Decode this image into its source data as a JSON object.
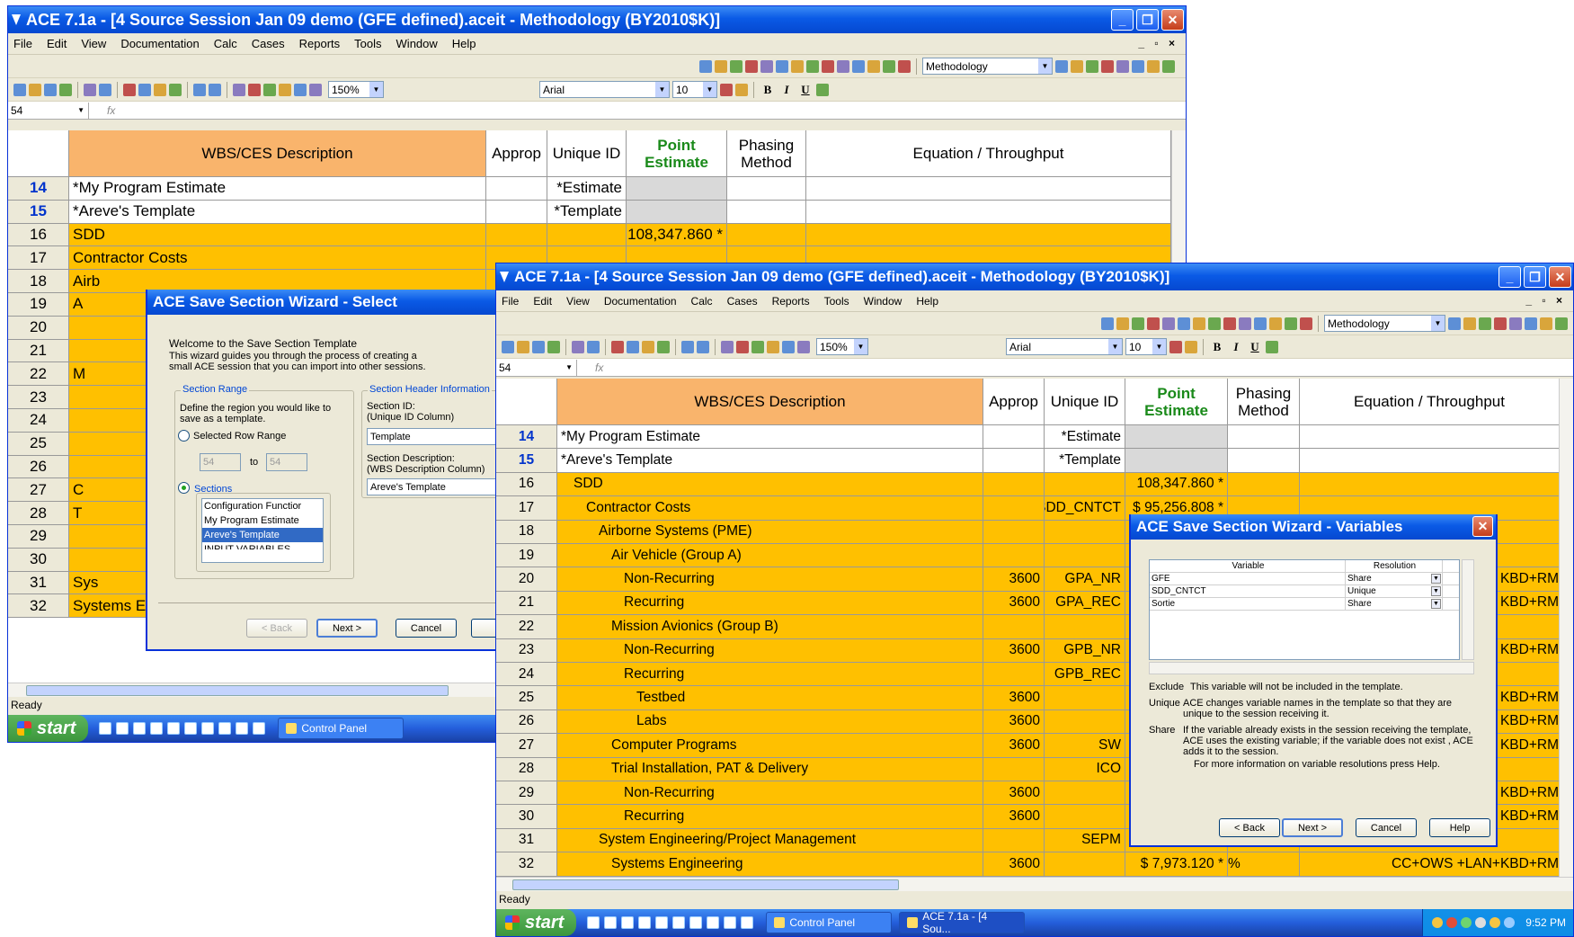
{
  "window_title": "ACE 7.1a - [4 Source Session Jan 09 demo (GFE defined).aceit - Methodology (BY2010$K)]",
  "menu": [
    "File",
    "Edit",
    "View",
    "Documentation",
    "Calc",
    "Cases",
    "Reports",
    "Tools",
    "Window",
    "Help"
  ],
  "mdi_controls": "_ ▫ ×",
  "toolbar": {
    "view_combo": "Methodology",
    "zoom": "150%",
    "font": "Arial",
    "font_size": "10",
    "bold": "B",
    "italic": "I",
    "underline": "U"
  },
  "name_box": "54",
  "fx_label": "fx",
  "columns": {
    "desc": "WBS/CES Description",
    "approp": "Approp",
    "uid": "Unique ID",
    "pe_line1": "Point",
    "pe_line2": "Estimate",
    "phase_line1": "Phasing",
    "phase_line2": "Method",
    "eq": "Equation / Throughput"
  },
  "back_rows": [
    {
      "num": "14",
      "desc": "*My Program Estimate",
      "uid": "*Estimate",
      "pe": "",
      "style": "white"
    },
    {
      "num": "15",
      "desc": "*Areve's Template",
      "uid": "*Template",
      "pe": "",
      "style": "white"
    },
    {
      "num": "16",
      "desc": "SDD",
      "uid": "",
      "pe": "108,347.860 *",
      "style": "yellow"
    },
    {
      "num": "17",
      "desc": "Contractor Costs",
      "uid": "",
      "pe": "",
      "style": "yellow"
    },
    {
      "num": "18",
      "desc": "Airb",
      "uid": "",
      "pe": "",
      "style": "yellow"
    },
    {
      "num": "19",
      "desc": "A",
      "uid": "",
      "pe": "",
      "style": "yellow"
    },
    {
      "num": "20",
      "desc": "",
      "uid": "",
      "pe": "",
      "style": "yellow"
    },
    {
      "num": "21",
      "desc": "",
      "uid": "",
      "pe": "",
      "style": "yellow"
    },
    {
      "num": "22",
      "desc": "M",
      "uid": "",
      "pe": "",
      "style": "yellow"
    },
    {
      "num": "23",
      "desc": "",
      "uid": "",
      "pe": "",
      "style": "yellow"
    },
    {
      "num": "24",
      "desc": "",
      "uid": "",
      "pe": "",
      "style": "yellow"
    },
    {
      "num": "25",
      "desc": "",
      "uid": "",
      "pe": "",
      "style": "yellow"
    },
    {
      "num": "26",
      "desc": "",
      "uid": "",
      "pe": "",
      "style": "yellow"
    },
    {
      "num": "27",
      "desc": "C",
      "uid": "",
      "pe": "",
      "style": "yellow"
    },
    {
      "num": "28",
      "desc": "T",
      "uid": "",
      "pe": "",
      "style": "yellow"
    },
    {
      "num": "29",
      "desc": "",
      "uid": "",
      "pe": "",
      "style": "yellow"
    },
    {
      "num": "30",
      "desc": "",
      "uid": "",
      "pe": "",
      "style": "yellow"
    },
    {
      "num": "31",
      "desc": "Sys",
      "uid": "",
      "pe": "",
      "style": "yellow"
    },
    {
      "num": "32",
      "desc": "Systems Engineering",
      "uid": "",
      "pe": "",
      "style": "yellow"
    }
  ],
  "front_rows": [
    {
      "num": "14",
      "desc": "*My Program Estimate",
      "approp": "",
      "uid": "*Estimate",
      "pe": "",
      "phase": "",
      "eq": "",
      "style": "white",
      "indent": 0
    },
    {
      "num": "15",
      "desc": "*Areve's Template",
      "approp": "",
      "uid": "*Template",
      "pe": "",
      "phase": "",
      "eq": "",
      "style": "white",
      "indent": 0
    },
    {
      "num": "16",
      "desc": "SDD",
      "approp": "",
      "uid": "",
      "pe": "108,347.860 *",
      "phase": "",
      "eq": "",
      "style": "yellow",
      "indent": 1
    },
    {
      "num": "17",
      "desc": "Contractor Costs",
      "approp": "",
      "uid": "SDD_CNTCT",
      "pe": "$ 95,256.808 *",
      "phase": "",
      "eq": "",
      "style": "yellow",
      "indent": 2
    },
    {
      "num": "18",
      "desc": "Airborne Systems (PME)",
      "approp": "",
      "uid": "",
      "pe": "",
      "phase": "",
      "eq": "",
      "style": "yellow",
      "indent": 3
    },
    {
      "num": "19",
      "desc": "Air Vehicle (Group A)",
      "approp": "",
      "uid": "",
      "pe": "",
      "phase": "",
      "eq": "",
      "style": "yellow",
      "indent": 4
    },
    {
      "num": "20",
      "desc": "Non-Recurring",
      "approp": "3600",
      "uid": "GPA_NR",
      "pe": "",
      "phase": "",
      "eq": "KBD+RM",
      "style": "yellow",
      "indent": 5
    },
    {
      "num": "21",
      "desc": "Recurring",
      "approp": "3600",
      "uid": "GPA_REC",
      "pe": "",
      "phase": "",
      "eq": "KBD+RM",
      "style": "yellow",
      "indent": 5
    },
    {
      "num": "22",
      "desc": "Mission Avionics (Group B)",
      "approp": "",
      "uid": "",
      "pe": "",
      "phase": "",
      "eq": "",
      "style": "yellow",
      "indent": 4
    },
    {
      "num": "23",
      "desc": "Non-Recurring",
      "approp": "3600",
      "uid": "GPB_NR",
      "pe": "",
      "phase": "",
      "eq": "KBD+RM",
      "style": "yellow",
      "indent": 5
    },
    {
      "num": "24",
      "desc": "Recurring",
      "approp": "",
      "uid": "GPB_REC",
      "pe": "",
      "phase": "",
      "eq": "",
      "style": "yellow",
      "indent": 5
    },
    {
      "num": "25",
      "desc": "Testbed",
      "approp": "3600",
      "uid": "",
      "pe": "",
      "phase": "",
      "eq": "KBD+RM",
      "style": "yellow",
      "indent": 6
    },
    {
      "num": "26",
      "desc": "Labs",
      "approp": "3600",
      "uid": "",
      "pe": "",
      "phase": "",
      "eq": "KBD+RM",
      "style": "yellow",
      "indent": 6
    },
    {
      "num": "27",
      "desc": "Computer Programs",
      "approp": "3600",
      "uid": "SW",
      "pe": "",
      "phase": "",
      "eq": "KBD+RM",
      "style": "yellow",
      "indent": 4
    },
    {
      "num": "28",
      "desc": "Trial Installation, PAT & Delivery",
      "approp": "",
      "uid": "ICO",
      "pe": "",
      "phase": "",
      "eq": "",
      "style": "yellow",
      "indent": 4
    },
    {
      "num": "29",
      "desc": "Non-Recurring",
      "approp": "3600",
      "uid": "",
      "pe": "",
      "phase": "",
      "eq": "KBD+RM",
      "style": "yellow",
      "indent": 5
    },
    {
      "num": "30",
      "desc": "Recurring",
      "approp": "3600",
      "uid": "",
      "pe": "",
      "phase": "",
      "eq": "KBD+RM",
      "style": "yellow",
      "indent": 5
    },
    {
      "num": "31",
      "desc": "System Engineering/Project Management",
      "approp": "",
      "uid": "SEPM",
      "pe": "",
      "phase": "",
      "eq": "",
      "style": "yellow",
      "indent": 3
    },
    {
      "num": "32",
      "desc": "Systems Engineering",
      "approp": "3600",
      "uid": "",
      "pe": "$ 7,973.120 *",
      "phase": "%",
      "eq": "CC+OWS +LAN+KBD+RM",
      "style": "yellow",
      "indent": 4
    }
  ],
  "status": "Ready",
  "taskbar": {
    "start": "start",
    "items": [
      "Control Panel",
      "ACE 7.1a - [4 Sou..."
    ],
    "clock": "9:52 PM"
  },
  "select_dialog": {
    "title": "ACE Save Section Wizard - Select",
    "welcome": "Welcome to the Save Section Template",
    "intro": "This wizard guides you through the process of creating a small ACE session that you can import into other sessions.",
    "range_group": "Section Range",
    "range_text": "Define the region you would like to save as a template.",
    "selected_row_range": "Selected Row Range",
    "from": "54",
    "to_label": "to",
    "to": "54",
    "sections_label": "Sections",
    "sections": [
      "Configuration Functior",
      "My Program Estimate",
      "Areve's Template",
      "INPUT VARIABLES"
    ],
    "header_group": "Section Header Information",
    "section_id_label": "Section ID:",
    "section_id_sub": "(Unique ID Column)",
    "section_id": "Template",
    "section_desc_label": "Section Description:",
    "section_desc_sub": "(WBS Description Column)",
    "section_desc": "Areve's Template",
    "back": "< Back",
    "next": "Next >",
    "cancel": "Cancel"
  },
  "variables_dialog": {
    "title": "ACE Save Section Wizard - Variables",
    "col_variable": "Variable",
    "col_resolution": "Resolution",
    "rows": [
      {
        "variable": "GFE",
        "resolution": "Share"
      },
      {
        "variable": "SDD_CNTCT",
        "resolution": "Unique"
      },
      {
        "variable": "Sortie",
        "resolution": "Share"
      }
    ],
    "exclude_label": "Exclude",
    "exclude_text": "This variable will not be included in the template.",
    "unique_label": "Unique",
    "unique_text": "ACE changes variable names in the template so that they are  unique to the session receiving it.",
    "share_label": "Share",
    "share_text": "If the variable already exists in the session receiving the template, ACE uses the existing variable; if the variable does not exist , ACE adds it to the session.",
    "more_info": "For more information on variable resolutions press Help.",
    "back": "< Back",
    "next": "Next >",
    "cancel": "Cancel",
    "help": "Help"
  }
}
